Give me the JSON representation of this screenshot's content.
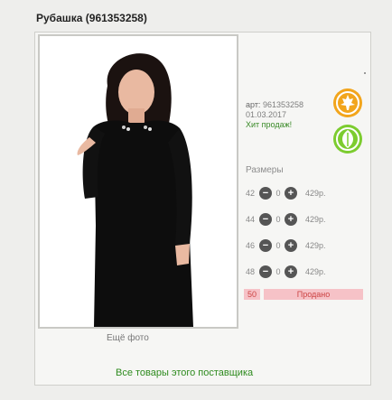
{
  "product": {
    "title": "Рубашка (961353258)",
    "article_label": "арт:",
    "article": "961353258",
    "date": "01.03.2017",
    "hit": "Хит продаж!"
  },
  "sizes": {
    "title": "Размеры",
    "rows": [
      {
        "size": "42",
        "qty": "0",
        "price": "429р."
      },
      {
        "size": "44",
        "qty": "0",
        "price": "429р."
      },
      {
        "size": "46",
        "qty": "0",
        "price": "429р."
      },
      {
        "size": "48",
        "qty": "0",
        "price": "429р."
      }
    ],
    "sold_qty": "50",
    "sold_label": "Продано"
  },
  "links": {
    "more_photo": "Ещё фото",
    "all_goods": "Все товары этого поставщика"
  },
  "icons": {
    "minus": "−",
    "plus": "+",
    "orange_badge": "maple-leaf-icon",
    "green_badge": "leaf-icon"
  },
  "colors": {
    "accent_green": "#2e8b1e",
    "badge_orange": "#f2a51c",
    "badge_green": "#7ccc2f",
    "sold_bg": "#f6c2c7"
  }
}
